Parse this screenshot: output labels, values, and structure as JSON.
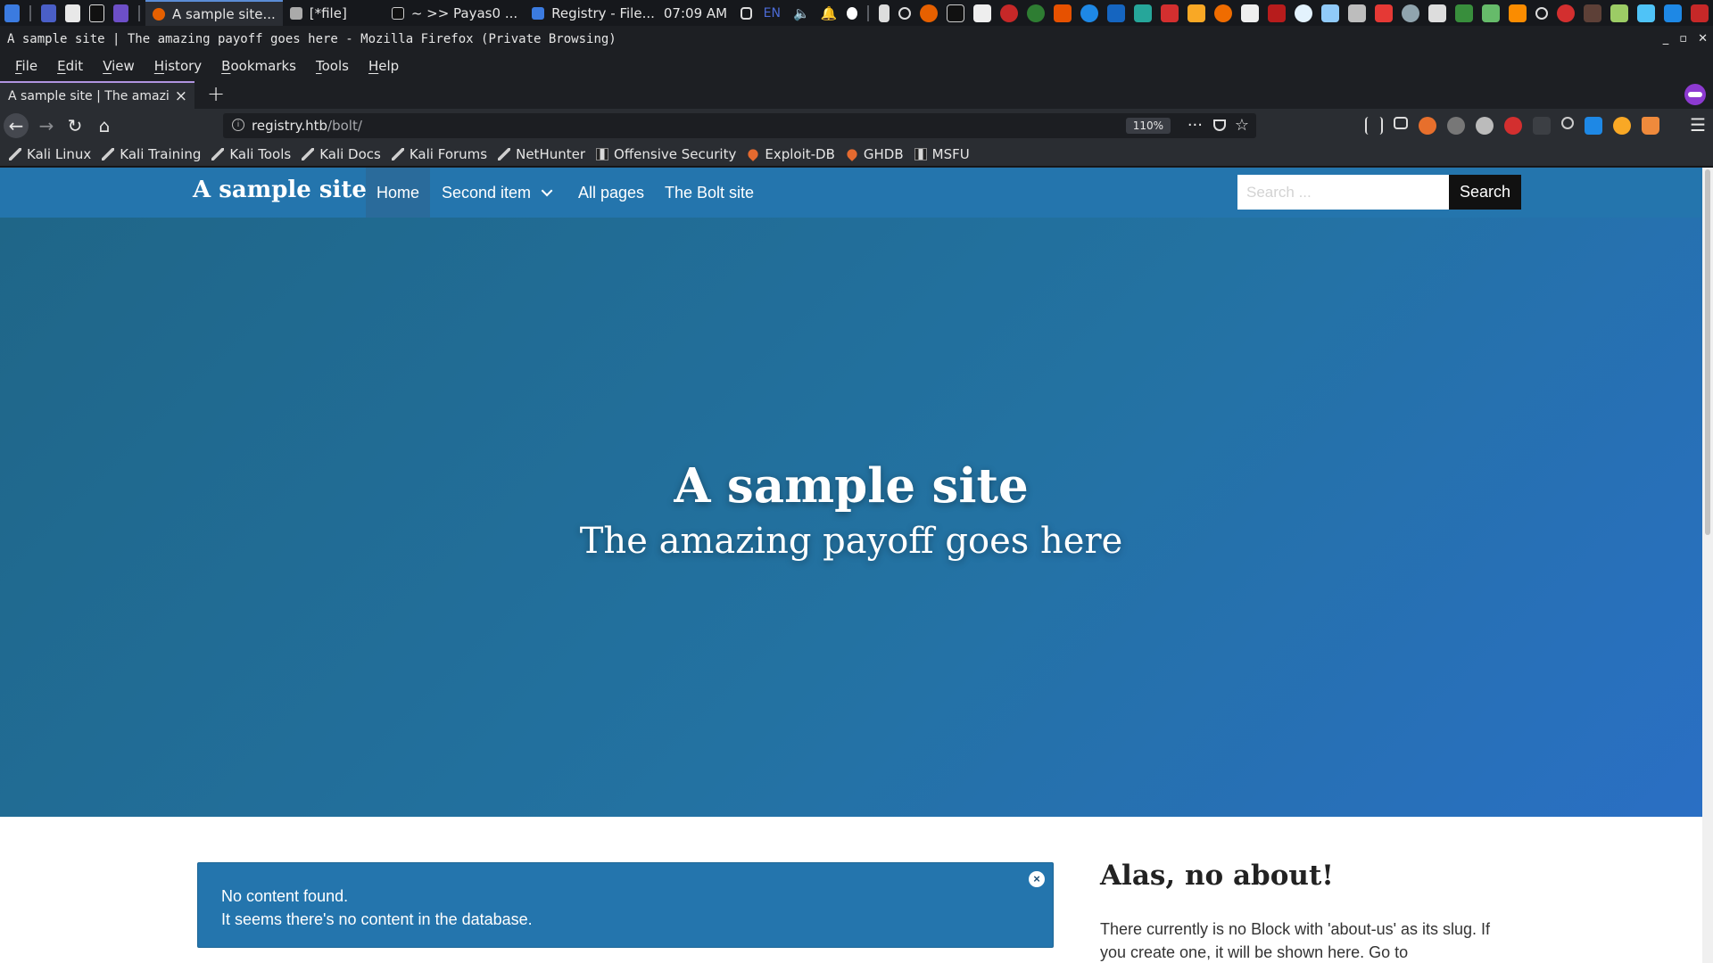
{
  "taskbar": {
    "tasks": [
      {
        "label": "A sample site...",
        "active": true
      },
      {
        "label": "[*file]"
      },
      {
        "label": "~ >> Payas0 ..."
      },
      {
        "label": "Registry - File..."
      }
    ],
    "clock": "07:09 AM",
    "lang": "EN"
  },
  "window": {
    "title": "A sample site | The amazing payoff goes here - Mozilla Firefox (Private Browsing)"
  },
  "menubar": {
    "items": [
      "File",
      "Edit",
      "View",
      "History",
      "Bookmarks",
      "Tools",
      "Help"
    ]
  },
  "tab": {
    "label": "A sample site | The amazing payoff goes here"
  },
  "navbar": {
    "url_host": "registry.htb",
    "url_path": "/bolt/",
    "zoom": "110%"
  },
  "bookmarks": [
    {
      "label": "Kali Linux",
      "icon": "kali-dragon-icon"
    },
    {
      "label": "Kali Training",
      "icon": "kali-dragon-icon"
    },
    {
      "label": "Kali Tools",
      "icon": "kali-dragon-icon"
    },
    {
      "label": "Kali Docs",
      "icon": "kali-dragon-icon"
    },
    {
      "label": "Kali Forums",
      "icon": "kali-dragon-icon"
    },
    {
      "label": "NetHunter",
      "icon": "kali-dragon-icon"
    },
    {
      "label": "Offensive Security",
      "icon": "offsec-icon"
    },
    {
      "label": "Exploit-DB",
      "icon": "exploitdb-icon"
    },
    {
      "label": "GHDB",
      "icon": "exploitdb-icon"
    },
    {
      "label": "MSFU",
      "icon": "offsec-icon"
    }
  ],
  "site": {
    "brand": "A sample site",
    "nav": {
      "home": "Home",
      "second": "Second item",
      "all_pages": "All pages",
      "bolt_site": "The Bolt site"
    },
    "search_placeholder": "Search ...",
    "search_button": "Search",
    "hero": {
      "title": "A sample site",
      "subtitle": "The amazing payoff goes here"
    },
    "alert": {
      "line1": "No content found.",
      "line2": "It seems there's no content in the database.",
      "close": "×"
    },
    "aside": {
      "title": "Alas, no about!",
      "text": "There currently is no Block with 'about-us' as its slug. If you create one, it will be shown here. Go to 'Configuration'"
    }
  },
  "colors": {
    "site_nav": "#2475ad",
    "hero_start": "#1f6688",
    "hero_end": "#2a6fc4",
    "private_accent": "#8d3ad1"
  }
}
